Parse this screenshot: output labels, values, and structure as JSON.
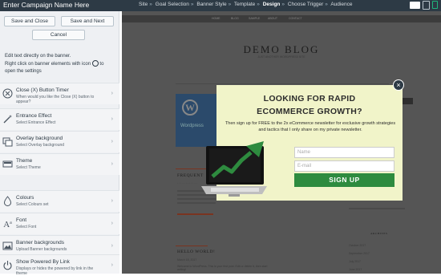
{
  "header": {
    "campaign_name": "Enter Campaign Name Here",
    "steps": [
      "Site",
      "Goal Selection",
      "Banner Style",
      "Template",
      "Design",
      "Choose Trigger",
      "Audience"
    ],
    "active_step": "Design",
    "separator": "»",
    "devices": [
      "desktop-icon",
      "tablet-icon",
      "mobile-icon"
    ]
  },
  "sidebar": {
    "save_close": "Save and Close",
    "save_next": "Save and Next",
    "cancel": "Cancel",
    "help_line1": "Edit text directly on the banner.",
    "help_line2": "Right click on banner elements with icon",
    "help_line3": "to",
    "help_line4": "open the settings",
    "items": [
      {
        "title": "Close (X) Button Timer",
        "subtitle": "When would you like the Close (X) button to appear?",
        "icon": "close-circle-icon"
      },
      {
        "title": "Entrance Effect",
        "subtitle": "Select Entrance Effect",
        "icon": "magic-wand-icon"
      },
      {
        "title": "Overlay background",
        "subtitle": "Select Overlay background",
        "icon": "overlay-icon"
      },
      {
        "title": "Theme",
        "subtitle": "Select Theme",
        "icon": "theme-icon"
      },
      {
        "title": "Colours",
        "subtitle": "Select Colours set",
        "icon": "colour-drop-icon"
      },
      {
        "title": "Font",
        "subtitle": "Select Font",
        "icon": "font-icon"
      },
      {
        "title": "Banner backgrounds",
        "subtitle": "Upload Banner backgrounds",
        "icon": "image-icon"
      },
      {
        "title": "Show Powered By Link",
        "subtitle": "Displays or hides the powered by link in the theme",
        "icon": "power-icon"
      }
    ]
  },
  "preview": {
    "blog_title": "DEMO BLOG",
    "blog_subtitle": "JUST ANOTHER WORDPRESS SITE",
    "post_image_text": "Wordpress",
    "post1_title": "FREQUENT",
    "post2_title": "HELLO WORLD!",
    "post2_date": "March 18, 2017",
    "post_excerpt": "Welcome to WordPress. This is your first post. Edit or delete it, then start writing!",
    "archives_title": "ARCHIVES",
    "archives": [
      "October 2017",
      "September 2017",
      "July 2017",
      "June 2017"
    ]
  },
  "popup": {
    "headline1": "LOOKING FOR RAPID",
    "headline2": "ECOMMERCE GROWTH?",
    "body": "Then sign up for FREE to the 2x eCommerce newsletter for exclusive growth strategies and tactics that I only share on my private newsletter.",
    "name_placeholder": "Name",
    "email_placeholder": "E-mail",
    "button": "SIGN UP",
    "close": "×",
    "accent_color": "#2e8b3f",
    "background_color": "#f1f4c9"
  }
}
